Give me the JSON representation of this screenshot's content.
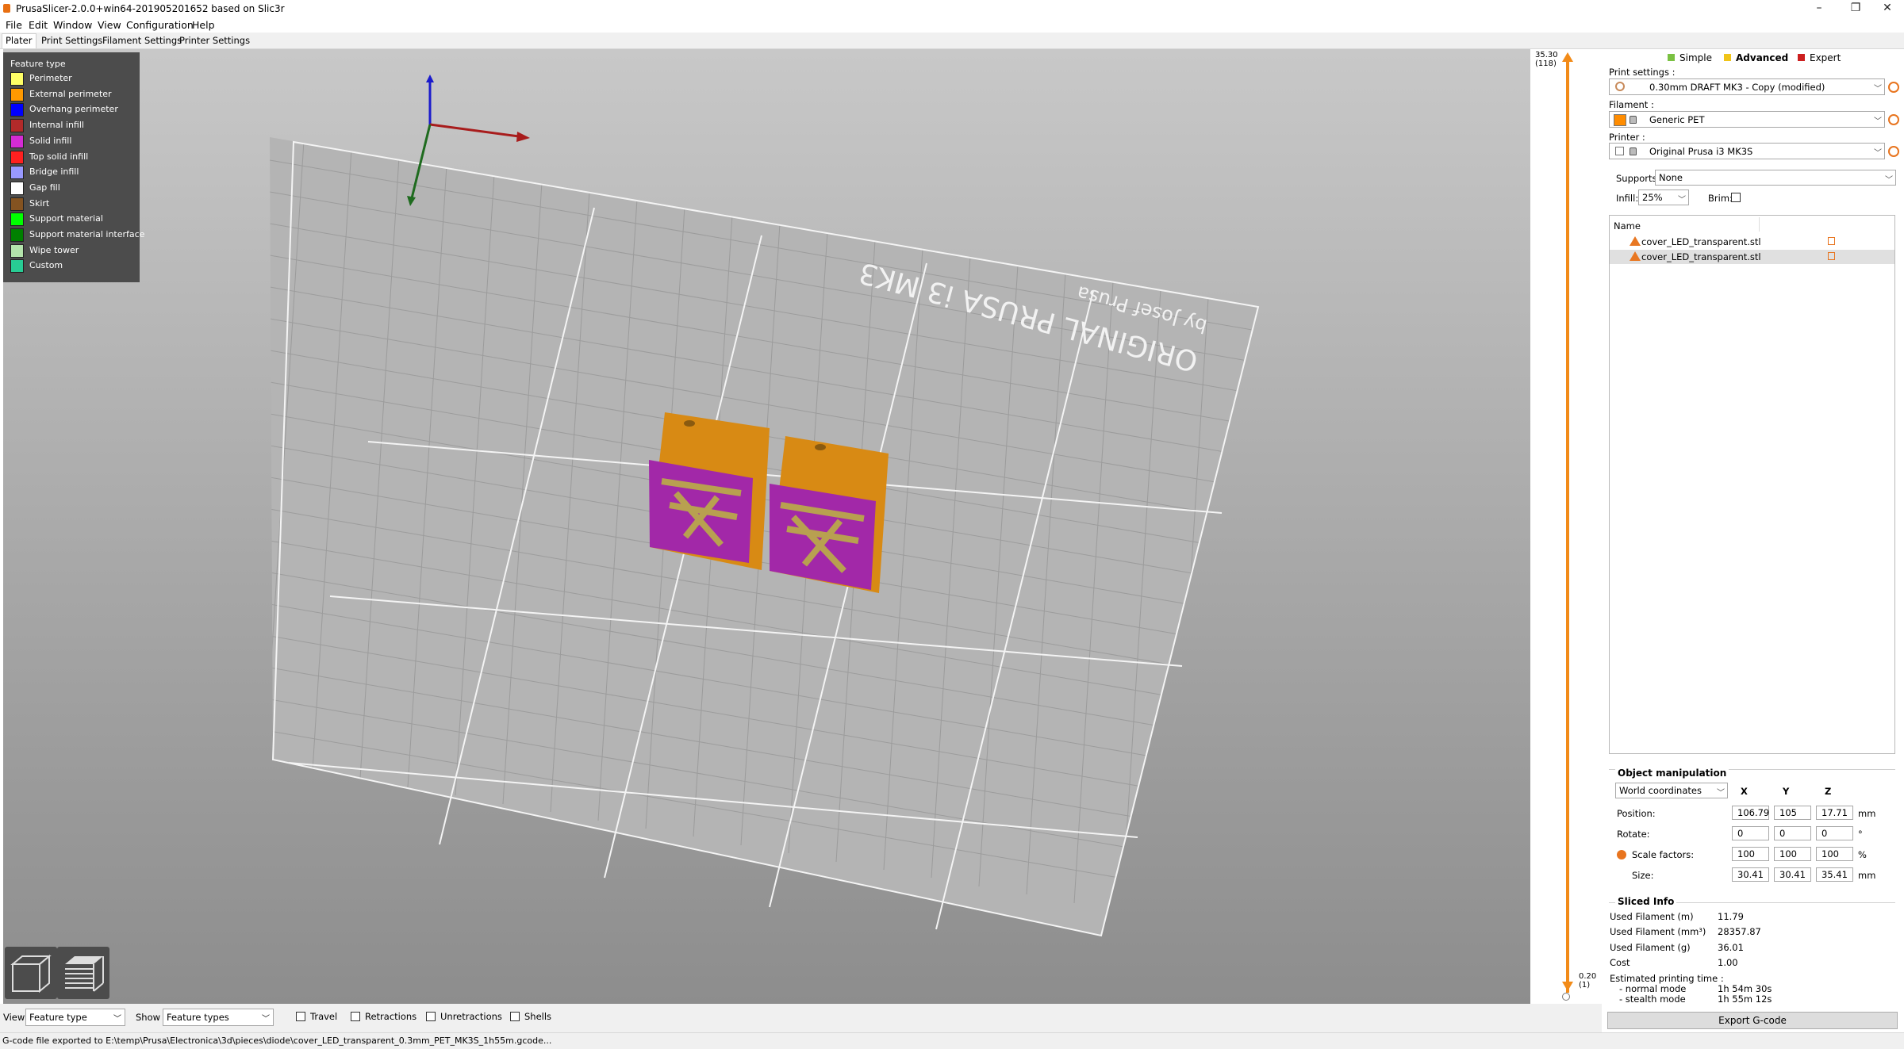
{
  "window": {
    "title": "PrusaSlicer-2.0.0+win64-201905201652 based on Slic3r",
    "controls": {
      "minimize": "–",
      "maximize": "❐",
      "close": "✕"
    }
  },
  "menu": [
    "File",
    "Edit",
    "Window",
    "View",
    "Configuration",
    "Help"
  ],
  "tabs": [
    "Plater",
    "Print Settings",
    "Filament Settings",
    "Printer Settings"
  ],
  "legend": {
    "title": "Feature type",
    "items": [
      {
        "label": "Perimeter",
        "color": "#ffff66"
      },
      {
        "label": "External perimeter",
        "color": "#ff9900"
      },
      {
        "label": "Overhang perimeter",
        "color": "#0000ff"
      },
      {
        "label": "Internal infill",
        "color": "#b22a2a"
      },
      {
        "label": "Solid infill",
        "color": "#d42bd4"
      },
      {
        "label": "Top solid infill",
        "color": "#ff2020"
      },
      {
        "label": "Bridge infill",
        "color": "#9999ff"
      },
      {
        "label": "Gap fill",
        "color": "#ffffff"
      },
      {
        "label": "Skirt",
        "color": "#845321"
      },
      {
        "label": "Support material",
        "color": "#00ff00"
      },
      {
        "label": "Support material interface",
        "color": "#008000"
      },
      {
        "label": "Wipe tower",
        "color": "#b3e3ab"
      },
      {
        "label": "Custom",
        "color": "#28cc94"
      }
    ]
  },
  "bed": {
    "line1": "ORIGINAL PRUSA i3 MK3",
    "line2": "by Josef Prusa"
  },
  "slider": {
    "top_value": "35.30",
    "top_layer": "(118)",
    "bottom_value": "0.20",
    "bottom_layer": "(1)"
  },
  "modes": [
    {
      "label": "Simple",
      "color": "#7ac142"
    },
    {
      "label": "Advanced",
      "color": "#f0c419"
    },
    {
      "label": "Expert",
      "color": "#cc1f1f"
    }
  ],
  "settings": {
    "print_label": "Print settings :",
    "print_value": "0.30mm DRAFT MK3 - Copy (modified)",
    "filament_label": "Filament :",
    "filament_value": "Generic PET",
    "filament_color": "#ff8c00",
    "printer_label": "Printer :",
    "printer_value": "Original Prusa i3 MK3S",
    "supports_label": "Supports:",
    "supports_value": "None",
    "infill_label": "Infill:",
    "infill_value": "25%",
    "brim_label": "Brim:"
  },
  "objects": {
    "header": "Name",
    "rows": [
      "cover_LED_transparent.stl",
      "cover_LED_transparent.stl"
    ]
  },
  "manipulation": {
    "title": "Object manipulation",
    "coords": "World coordinates",
    "axes": [
      "X",
      "Y",
      "Z"
    ],
    "rows": [
      {
        "label": "Position:",
        "values": [
          "106.79",
          "105",
          "17.71"
        ],
        "unit": "mm"
      },
      {
        "label": "Rotate:",
        "values": [
          "0",
          "0",
          "0"
        ],
        "unit": "°"
      },
      {
        "label": "Scale factors:",
        "values": [
          "100",
          "100",
          "100"
        ],
        "unit": "%"
      },
      {
        "label": "Size:",
        "values": [
          "30.41",
          "30.41",
          "35.41"
        ],
        "unit": "mm"
      }
    ]
  },
  "sliced": {
    "title": "Sliced Info",
    "rows": [
      {
        "label": "Used Filament (m)",
        "value": "11.79"
      },
      {
        "label": "Used Filament (mm³)",
        "value": "28357.87"
      },
      {
        "label": "Used Filament (g)",
        "value": "36.01"
      },
      {
        "label": "Cost",
        "value": "1.00"
      }
    ],
    "time_label": "Estimated printing time :",
    "normal_label": "- normal mode",
    "normal_value": "1h 54m 30s",
    "stealth_label": "- stealth mode",
    "stealth_value": "1h 55m 12s"
  },
  "export_label": "Export G-code",
  "bottom": {
    "view_label": "View",
    "view_value": "Feature type",
    "show_label": "Show",
    "show_value": "Feature types",
    "checks": [
      "Travel",
      "Retractions",
      "Unretractions",
      "Shells"
    ]
  },
  "status": "G-code file exported to E:\\temp\\Prusa\\Electronica\\3d\\pieces\\diode\\cover_LED_transparent_0.3mm_PET_MK3S_1h55m.gcode..."
}
